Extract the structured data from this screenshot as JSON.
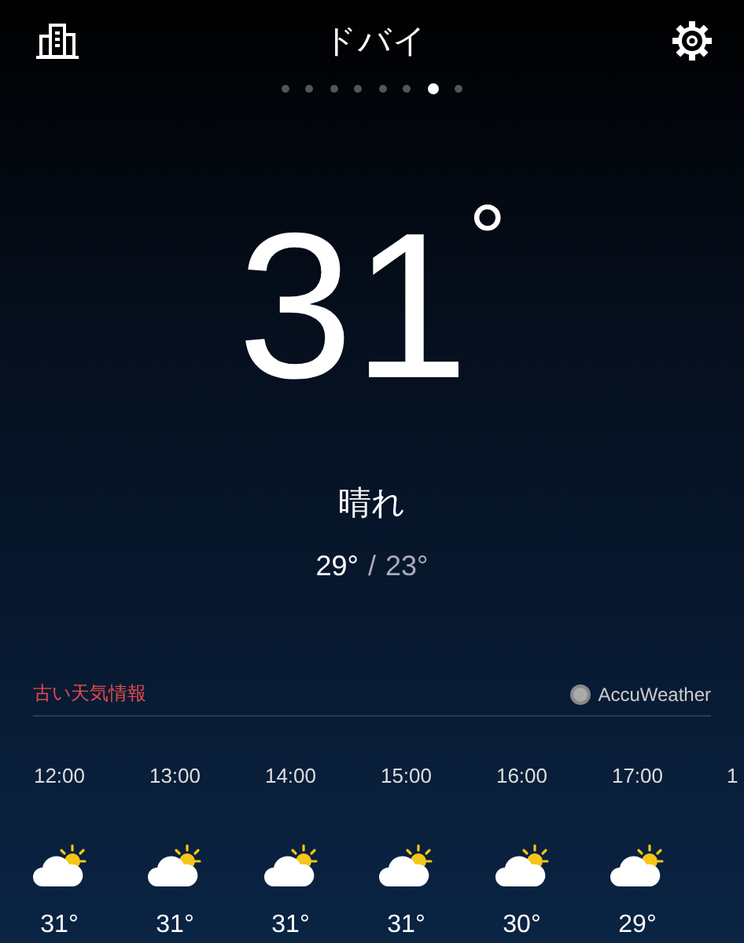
{
  "header": {
    "title": "ドバイ"
  },
  "page_dots": [
    {
      "selected": false
    },
    {
      "selected": false
    },
    {
      "selected": false
    },
    {
      "selected": false
    },
    {
      "selected": false
    },
    {
      "selected": false
    },
    {
      "selected": true
    },
    {
      "selected": false
    }
  ],
  "current": {
    "temperature": "31",
    "degree": "°",
    "condition": "晴れ",
    "high": "29°",
    "separator": "/",
    "low": "23°"
  },
  "notice": {
    "text": "古い天気情報",
    "provider": "AccuWeather"
  },
  "hourly": [
    {
      "time": "12:00",
      "temp": "31°"
    },
    {
      "time": "13:00",
      "temp": "31°"
    },
    {
      "time": "14:00",
      "temp": "31°"
    },
    {
      "time": "15:00",
      "temp": "31°"
    },
    {
      "time": "16:00",
      "temp": "30°"
    },
    {
      "time": "17:00",
      "temp": "29°"
    },
    {
      "time": "1"
    }
  ]
}
